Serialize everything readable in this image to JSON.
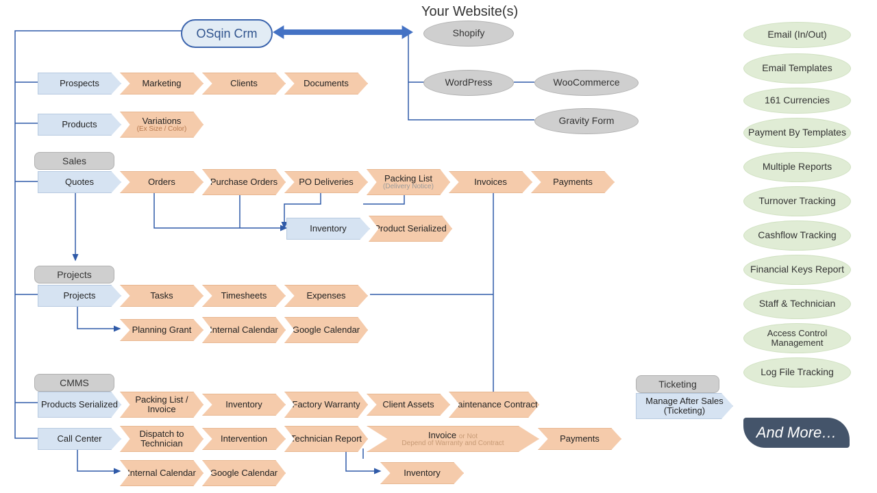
{
  "crm_name": "OSqin Crm",
  "website_title": "Your Website(s)",
  "websites": {
    "shopify": "Shopify",
    "wordpress": "WordPress",
    "woocommerce": "WooCommerce",
    "gravity": "Gravity Form"
  },
  "row1": {
    "prospects": "Prospects",
    "marketing": "Marketing",
    "clients": "Clients",
    "documents": "Documents"
  },
  "row2": {
    "products": "Products",
    "variations": "Variations",
    "variations_sub": "(Ex Size / Color)"
  },
  "sales_header": "Sales",
  "sales": {
    "quotes": "Quotes",
    "orders": "Orders",
    "po": "Purchase Orders",
    "po_deliv": "PO Deliveries",
    "packing": "Packing List",
    "packing_sub": "(Delivery Notice)",
    "invoices": "Invoices",
    "payments": "Payments",
    "inventory": "Inventory",
    "serialized": "Product Serialized"
  },
  "projects_header": "Projects",
  "projects": {
    "projects": "Projects",
    "tasks": "Tasks",
    "timesheets": "Timesheets",
    "expenses": "Expenses",
    "planning": "Planning Grant",
    "internal_cal": "Internal Calendar",
    "google_cal": "Google Calendar"
  },
  "cmms_header": "CMMS",
  "cmms": {
    "prod_ser": "Products Serialized",
    "packing_inv": "Packing List / Invoice",
    "inventory": "Inventory",
    "factory": "Factory Warranty",
    "client_assets": "Client Assets",
    "maint": "Maintenance Contract",
    "call_center": "Call Center",
    "dispatch": "Dispatch to Technician",
    "intervention": "Intervention",
    "tech_report": "Technician Report",
    "invoice": "Invoice",
    "invoice_sub1": "or Not",
    "invoice_sub2": "Depend  of Warranty and Contract",
    "payments": "Payments",
    "internal_cal": "Internal Calendar",
    "google_cal": "Google Calendar",
    "inventory2": "Inventory"
  },
  "ticketing_header": "Ticketing",
  "ticketing": {
    "manage": "Manage After Sales (Ticketing)"
  },
  "features": {
    "email_io": "Email (In/Out)",
    "email_tpl": "Email Templates",
    "currencies": "161 Currencies",
    "pay_tpl": "Payment By Templates",
    "reports": "Multiple Reports",
    "turnover": "Turnover Tracking",
    "cashflow": "Cashflow Tracking",
    "fin_keys": "Financial Keys Report",
    "staff": "Staff & Technician",
    "access": "Access Control Management",
    "logfile": "Log File Tracking"
  },
  "and_more": "And More…"
}
